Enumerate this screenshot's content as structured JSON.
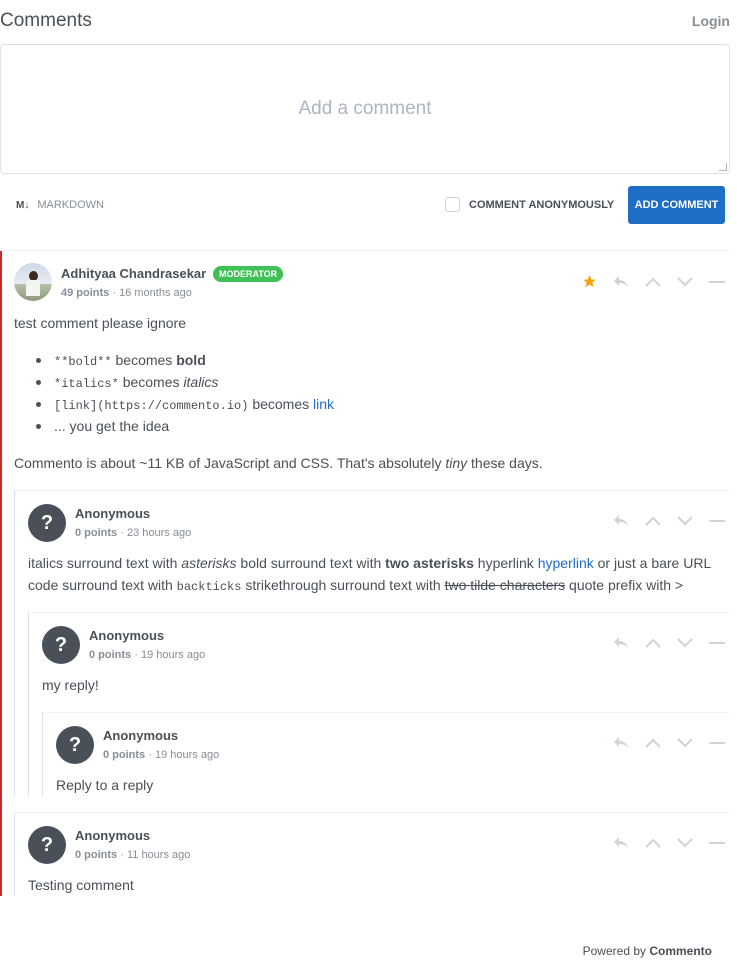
{
  "header": {
    "title": "Comments",
    "login": "Login"
  },
  "composer": {
    "placeholder": "Add a comment",
    "markdown_icon": "M↓",
    "markdown_label": "MARKDOWN",
    "anonymous_label": "COMMENT ANONYMOUSLY",
    "submit_label": "ADD COMMENT"
  },
  "colors": {
    "accent": "#1e6ec6",
    "moderator": "#40c057",
    "thread_bar": "#c92a2a",
    "sticky_star": "#f59f00"
  },
  "comments": [
    {
      "author": "Adhityaa Chandrasekar",
      "badge": "MODERATOR",
      "points": "49 points",
      "sep": "·",
      "time": "16 months ago",
      "line1": "test comment please ignore",
      "bullets": [
        {
          "code": "**bold**",
          "mid": " becomes ",
          "rich": "bold"
        },
        {
          "code": "*italics*",
          "mid": " becomes ",
          "rich": "italics"
        },
        {
          "code": "[link](https://commento.io)",
          "mid": " becomes ",
          "rich": "link"
        },
        {
          "text": "... you get the idea"
        }
      ],
      "line2_a": "Commento is about ~11 KB of JavaScript and CSS. That's absolutely ",
      "line2_em": "tiny",
      "line2_b": " these days."
    },
    {
      "author": "Anonymous",
      "points": "0 points",
      "sep": "·",
      "time": "23 hours ago",
      "l1_a": "italics surround text with ",
      "l1_em": "asterisks",
      "l1_b": " bold surround text with ",
      "l1_strong": "two asterisks",
      "l1_c": " hyperlink ",
      "l1_link": "hyperlink",
      "l1_d": " or just a bare URL",
      "l2_a": "code surround text with ",
      "l2_code": "backticks",
      "l2_b": " strikethrough surround text with ",
      "l2_strike": "two tilde characters",
      "l2_c": " quote prefix with >"
    },
    {
      "author": "Anonymous",
      "points": "0 points",
      "sep": "·",
      "time": "19 hours ago",
      "text": "my reply!"
    },
    {
      "author": "Anonymous",
      "points": "0 points",
      "sep": "·",
      "time": "19 hours ago",
      "text": "Reply to a reply"
    },
    {
      "author": "Anonymous",
      "points": "0 points",
      "sep": "·",
      "time": "11 hours ago",
      "text": "Testing comment"
    }
  ],
  "anon_avatar": "?",
  "footer": {
    "prefix": "Powered by ",
    "brand": "Commento"
  }
}
